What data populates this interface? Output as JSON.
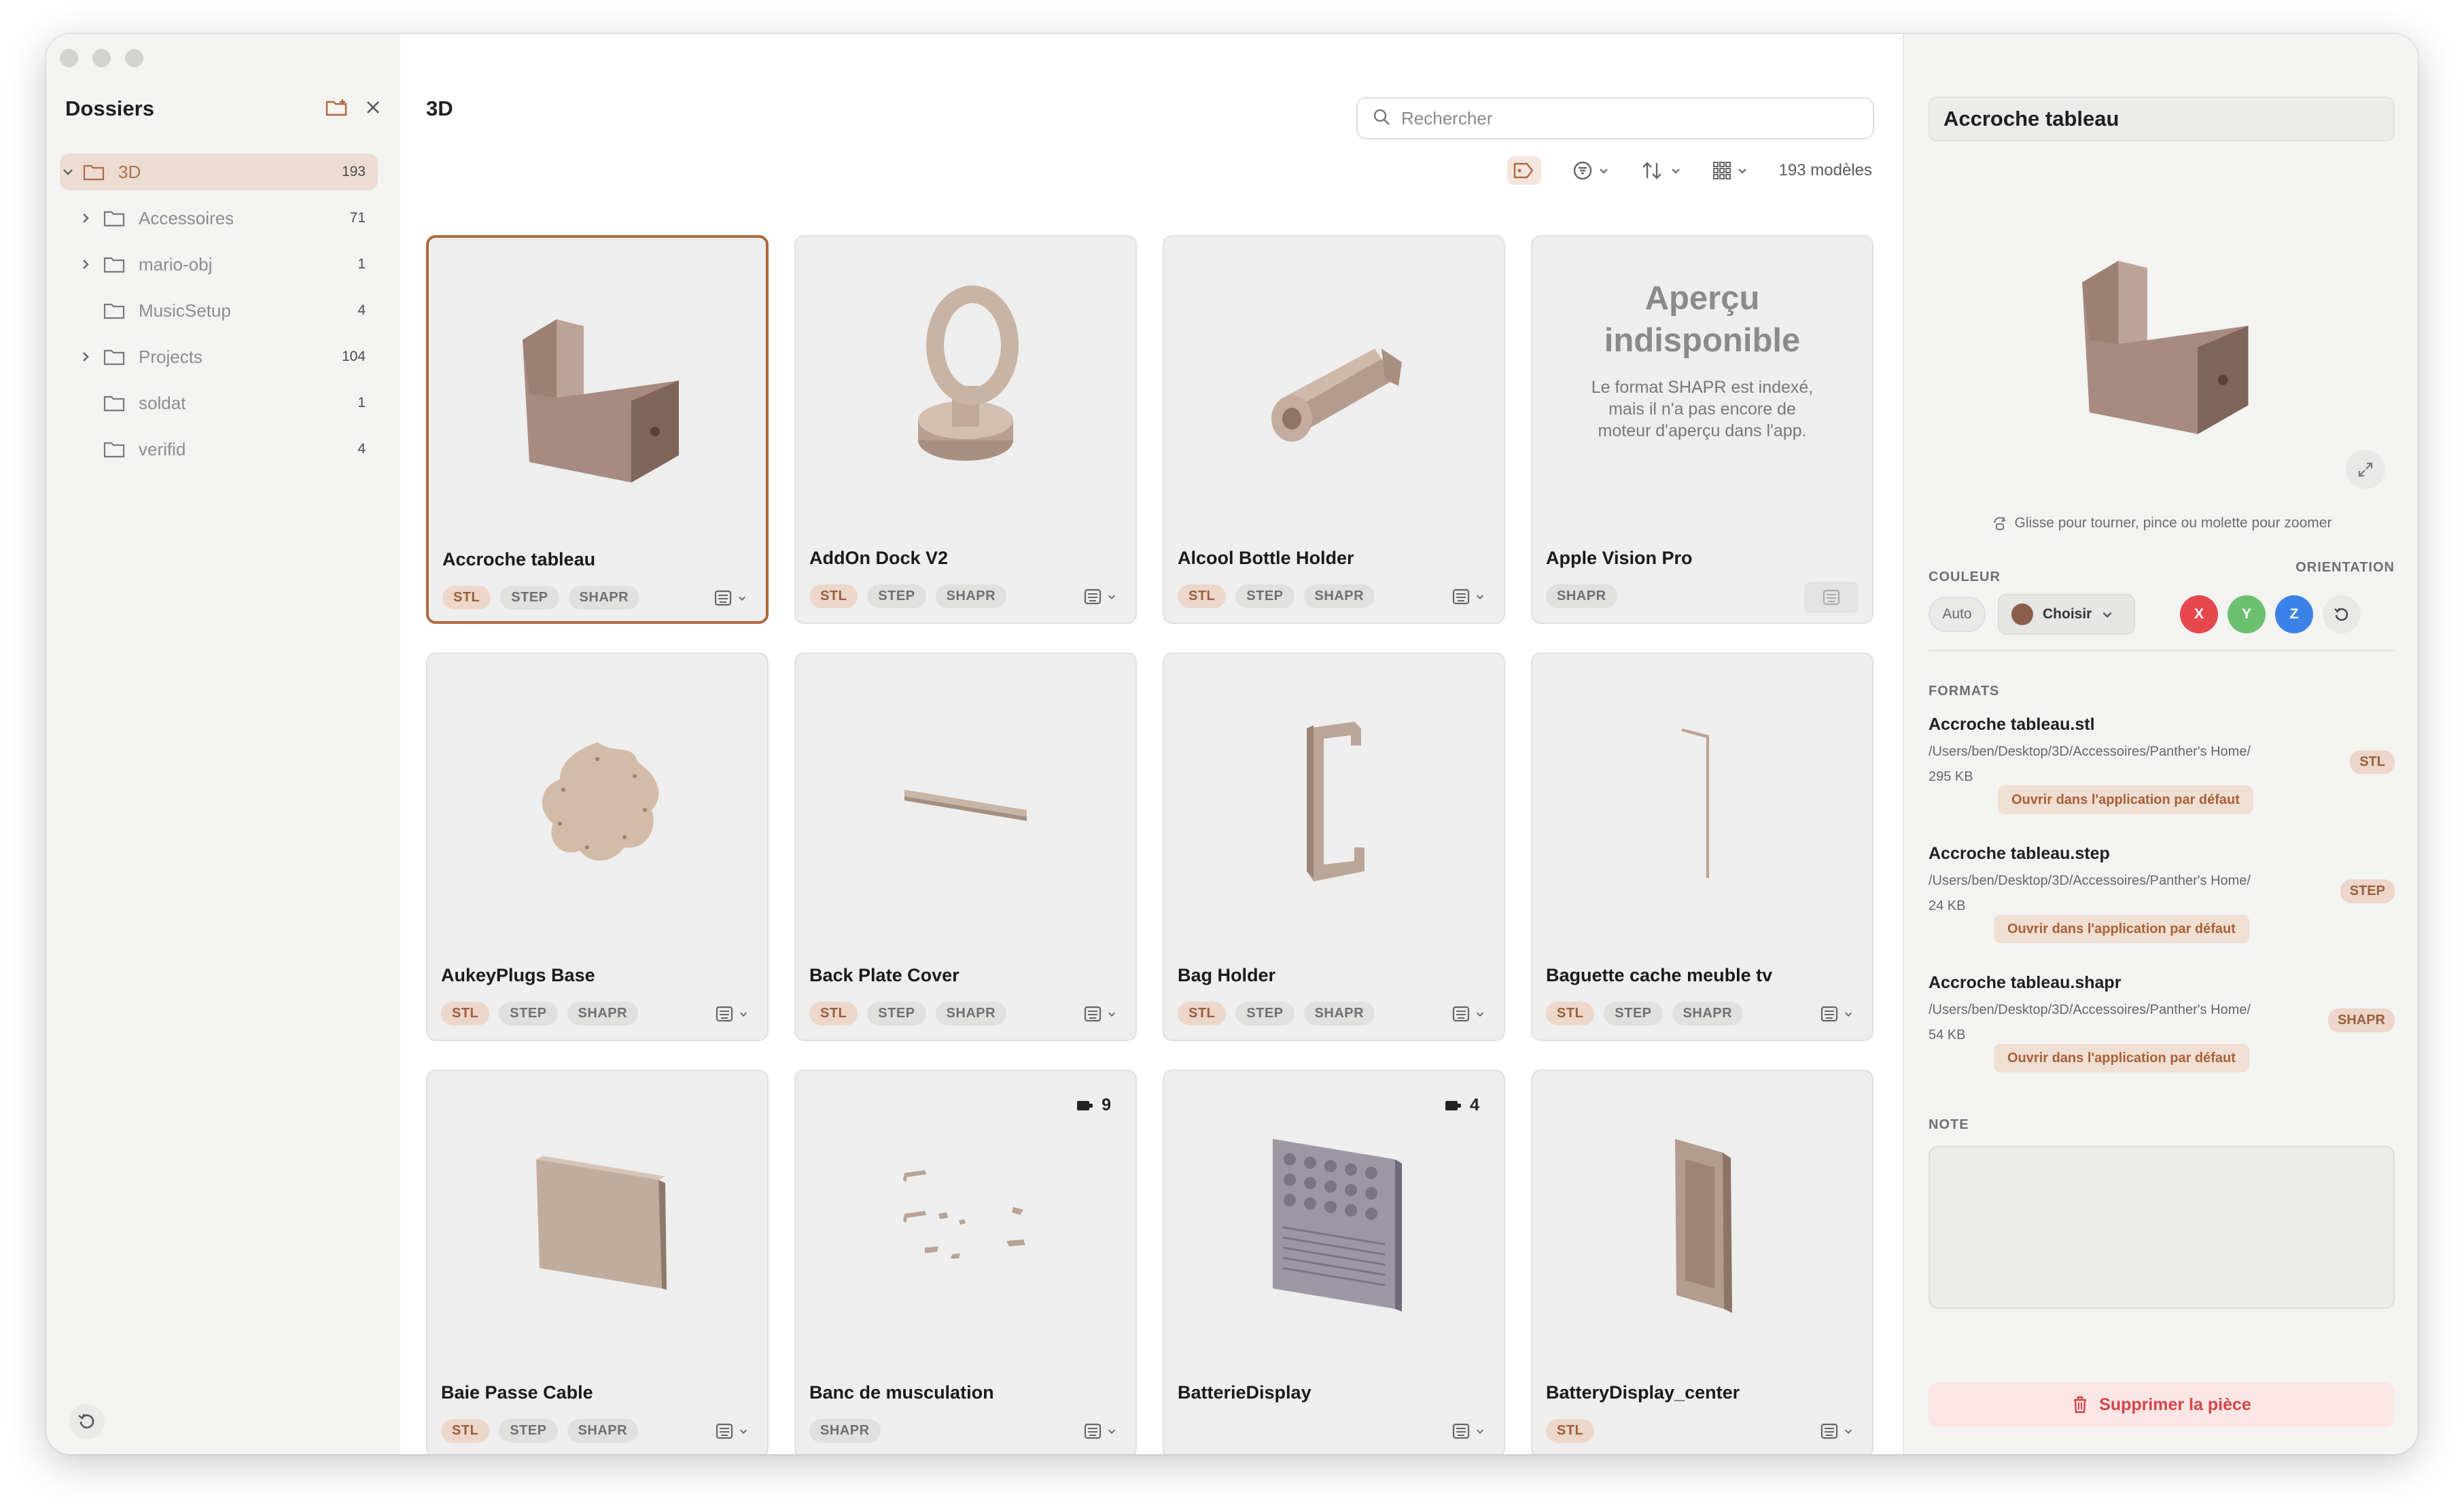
{
  "sidebar": {
    "title": "Dossiers",
    "tree": [
      {
        "label": "3D",
        "count": "193",
        "expanded": true,
        "selected": true
      },
      {
        "label": "Accessoires",
        "count": "71",
        "has_children": true
      },
      {
        "label": "mario-obj",
        "count": "1",
        "has_children": true
      },
      {
        "label": "MusicSetup",
        "count": "4",
        "has_children": false
      },
      {
        "label": "Projects",
        "count": "104",
        "has_children": true
      },
      {
        "label": "soldat",
        "count": "1",
        "has_children": false
      },
      {
        "label": "verifid",
        "count": "4",
        "has_children": false
      }
    ]
  },
  "main": {
    "title": "3D",
    "search_placeholder": "Rechercher",
    "count_label": "193 modèles",
    "cards": [
      {
        "name": "Accroche tableau",
        "tags": [
          "STL",
          "STEP",
          "SHAPR"
        ],
        "thumb": "hook-block",
        "selected": true
      },
      {
        "name": "AddOn Dock V2",
        "tags": [
          "STL",
          "STEP",
          "SHAPR"
        ],
        "thumb": "ring-stand"
      },
      {
        "name": "Alcool Bottle Holder",
        "tags": [
          "STL",
          "STEP",
          "SHAPR"
        ],
        "thumb": "cylinder"
      },
      {
        "name": "Apple Vision Pro",
        "tags": [
          "SHAPR"
        ],
        "thumb": "none"
      },
      {
        "name": "AukeyPlugs Base",
        "tags": [
          "STL",
          "STEP",
          "SHAPR"
        ],
        "thumb": "flower-plate"
      },
      {
        "name": "Back Plate Cover",
        "tags": [
          "STL",
          "STEP",
          "SHAPR"
        ],
        "thumb": "thin-bar"
      },
      {
        "name": "Bag Holder",
        "tags": [
          "STL",
          "STEP",
          "SHAPR"
        ],
        "thumb": "c-hook"
      },
      {
        "name": "Baguette cache meuble tv",
        "tags": [
          "STL",
          "STEP",
          "SHAPR"
        ],
        "thumb": "rod"
      },
      {
        "name": "Baie Passe Cable",
        "tags": [
          "STL",
          "STEP",
          "SHAPR"
        ],
        "thumb": "panel"
      },
      {
        "name": "Banc de musculation",
        "tags": [
          "SHAPR"
        ],
        "thumb": "parts",
        "badge": "9"
      },
      {
        "name": "BatterieDisplay",
        "tags": [],
        "thumb": "grid-block",
        "badge": "4"
      },
      {
        "name": "BatteryDisplay_center",
        "tags": [
          "STL"
        ],
        "thumb": "slab"
      }
    ],
    "no_preview": {
      "heading_line1": "Aperçu",
      "heading_line2": "indisponible",
      "text_line1": "Le format SHAPR est indexé,",
      "text_line2": "mais il n'a pas encore de",
      "text_line3": "moteur d'aperçu dans l'app."
    }
  },
  "panel": {
    "name": "Accroche tableau",
    "hint": "Glisse pour tourner, pince ou molette pour zoomer",
    "color_label": "COULEUR",
    "orientation_label": "ORIENTATION",
    "auto_label": "Auto",
    "choose_label": "Choisir",
    "axes": [
      "X",
      "Y",
      "Z"
    ],
    "axis_colors": [
      "#e5484d",
      "#6cc070",
      "#3b82e8"
    ],
    "swatch_color": "#8a5e4c",
    "formats_label": "FORMATS",
    "formats": [
      {
        "file": "Accroche tableau.stl",
        "path": "/Users/ben/Desktop/3D/Accessoires/Panther's Home/",
        "size": "295 KB",
        "tag": "STL",
        "open": "Ouvrir dans l'application par défaut"
      },
      {
        "file": "Accroche tableau.step",
        "path": "/Users/ben/Desktop/3D/Accessoires/Panther's Home/",
        "size": "24 KB",
        "tag": "STEP",
        "open": "Ouvrir dans l'application par défaut"
      },
      {
        "file": "Accroche tableau.shapr",
        "path": "/Users/ben/Desktop/3D/Accessoires/Panther's Home/",
        "size": "54 KB",
        "tag": "SHAPR",
        "open": "Ouvrir dans l'application par défaut"
      }
    ],
    "note_label": "NOTE",
    "delete_label": "Supprimer la pièce"
  },
  "colors": {
    "accent": "#b0683f",
    "tag_bg": "#ecd7ca",
    "delete": "#d64545"
  }
}
